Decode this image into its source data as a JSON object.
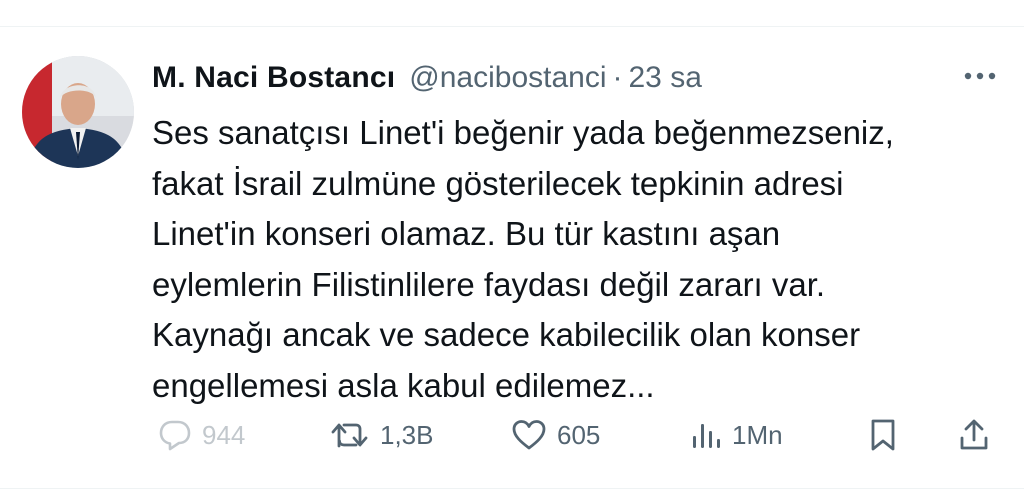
{
  "tweet": {
    "author_name": "M. Naci Bostancı",
    "handle": "@nacibostanci",
    "separator": "·",
    "time": "23 sa",
    "text_lines": [
      "Ses sanatçısı Linet'i beğenir yada beğenmezseniz,",
      "fakat İsrail zulmüne gösterilecek tepkinin adresi",
      "Linet'in konseri olamaz. Bu tür kastını aşan",
      "eylemlerin Filistinlilere faydası değil zararı var.",
      "Kaynağı ancak ve sadece kabilecilik olan konser",
      "engellemesi asla kabul edilemez..."
    ]
  },
  "actions": {
    "replies": "944",
    "retweets": "1,3B",
    "likes": "605",
    "views": "1Mn"
  },
  "icons": {
    "reply": "reply-icon",
    "retweet": "retweet-icon",
    "like": "heart-icon",
    "views": "views-icon",
    "bookmark": "bookmark-icon",
    "share": "share-icon",
    "more": "more-icon"
  },
  "colors": {
    "text": "#0f1419",
    "secondary": "#536471",
    "divider": "#eff3f4"
  }
}
